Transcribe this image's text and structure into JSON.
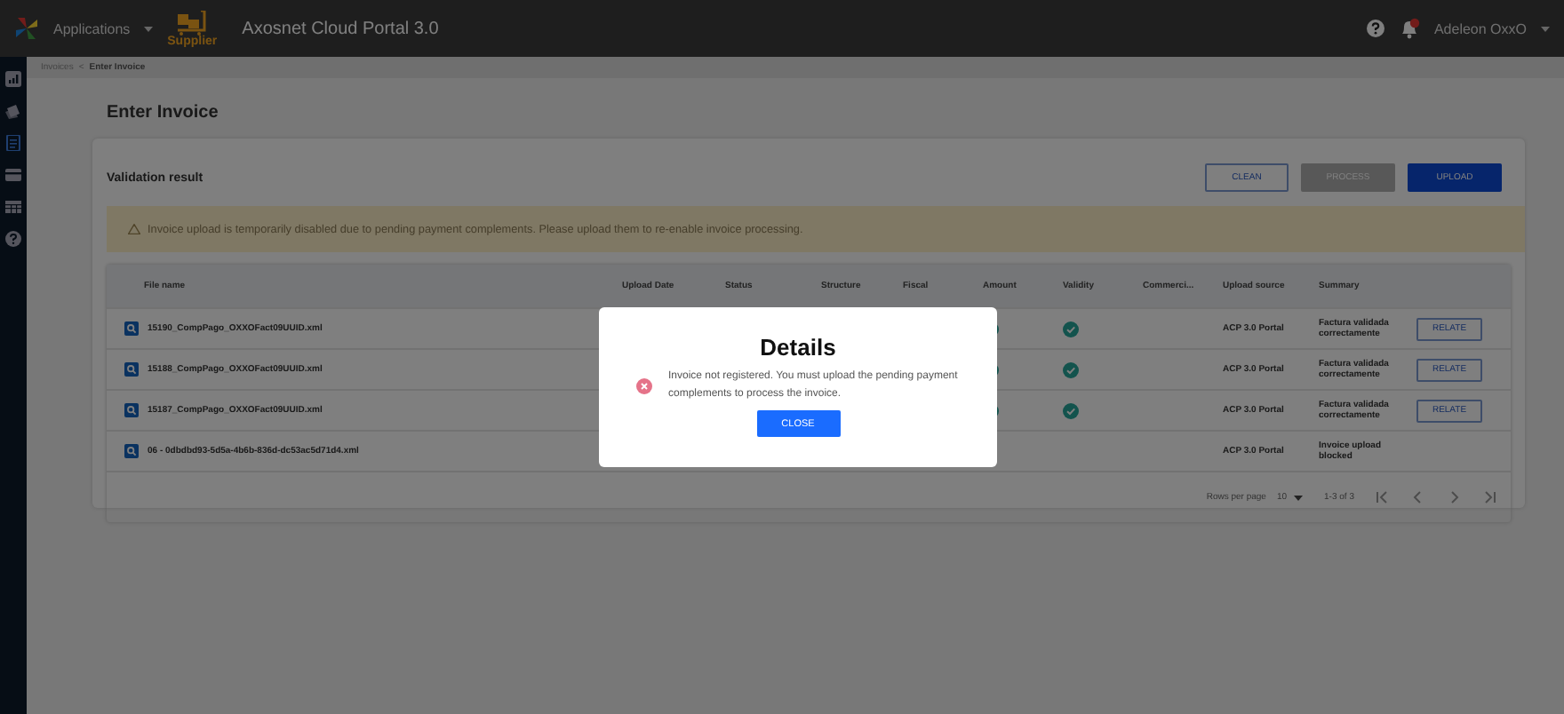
{
  "top_bar": {
    "apps_menu": "Applications",
    "logo_text": "Supplier",
    "title": "Axosnet Cloud Portal 3.0",
    "user": "Adeleon OxxO"
  },
  "sidebar": {
    "items": [
      {
        "kind": "chart",
        "selected": false
      },
      {
        "kind": "notes",
        "selected": false
      },
      {
        "kind": "document",
        "selected": true
      },
      {
        "kind": "card",
        "selected": false
      },
      {
        "kind": "table",
        "selected": false
      },
      {
        "kind": "help",
        "selected": false
      }
    ]
  },
  "breadcrumb": [
    "Invoices",
    "<",
    "Enter Invoice"
  ],
  "page_title": "Enter Invoice",
  "section_title": "Validation result",
  "buttons": [
    {
      "label": "CLEAN",
      "kind": "outlined",
      "disabled": false
    },
    {
      "label": "PROCESS",
      "kind": "filled",
      "disabled": true
    },
    {
      "label": "UPLOAD",
      "kind": "filled",
      "disabled": false
    }
  ],
  "warning": "Invoice upload is temporarily disabled due to pending payment complements. Please upload them to re-enable invoice processing.",
  "table": {
    "columns": [
      "File name",
      "Upload Date",
      "Status",
      "Structure",
      "Fiscal",
      "Amount",
      "Validity",
      "Commerci...",
      "Upload source",
      "Summary"
    ],
    "rows": [
      {
        "file_name": "15190_CompPago_OXXOFact09UUID.xml",
        "amount_valid": true,
        "validity_valid": true,
        "upload_source": "ACP 3.0 Portal",
        "summary": "Factura validada correctamente",
        "action": "RELATE"
      },
      {
        "file_name": "15188_CompPago_OXXOFact09UUID.xml",
        "amount_valid": true,
        "validity_valid": true,
        "upload_source": "ACP 3.0 Portal",
        "summary": "Factura validada correctamente",
        "action": "RELATE"
      },
      {
        "file_name": "15187_CompPago_OXXOFact09UUID.xml",
        "amount_valid": true,
        "validity_valid": true,
        "upload_source": "ACP 3.0 Portal",
        "summary": "Factura validada correctamente",
        "action": "RELATE"
      },
      {
        "file_name": "06 - 0dbdbd93-5d5a-4b6b-836d-dc53ac5d71d4.xml",
        "amount_valid": false,
        "validity_valid": false,
        "upload_source": "ACP 3.0 Portal",
        "summary": "Invoice upload blocked"
      }
    ],
    "pagination": {
      "rows_per_page_label": "Rows per page",
      "rows_per_page": "10",
      "range": "1-3 of 3"
    }
  },
  "dialog": {
    "title": "Details",
    "message": "Invoice not registered. You must upload the pending payment complements to process the invoice.",
    "button": "CLOSE"
  }
}
